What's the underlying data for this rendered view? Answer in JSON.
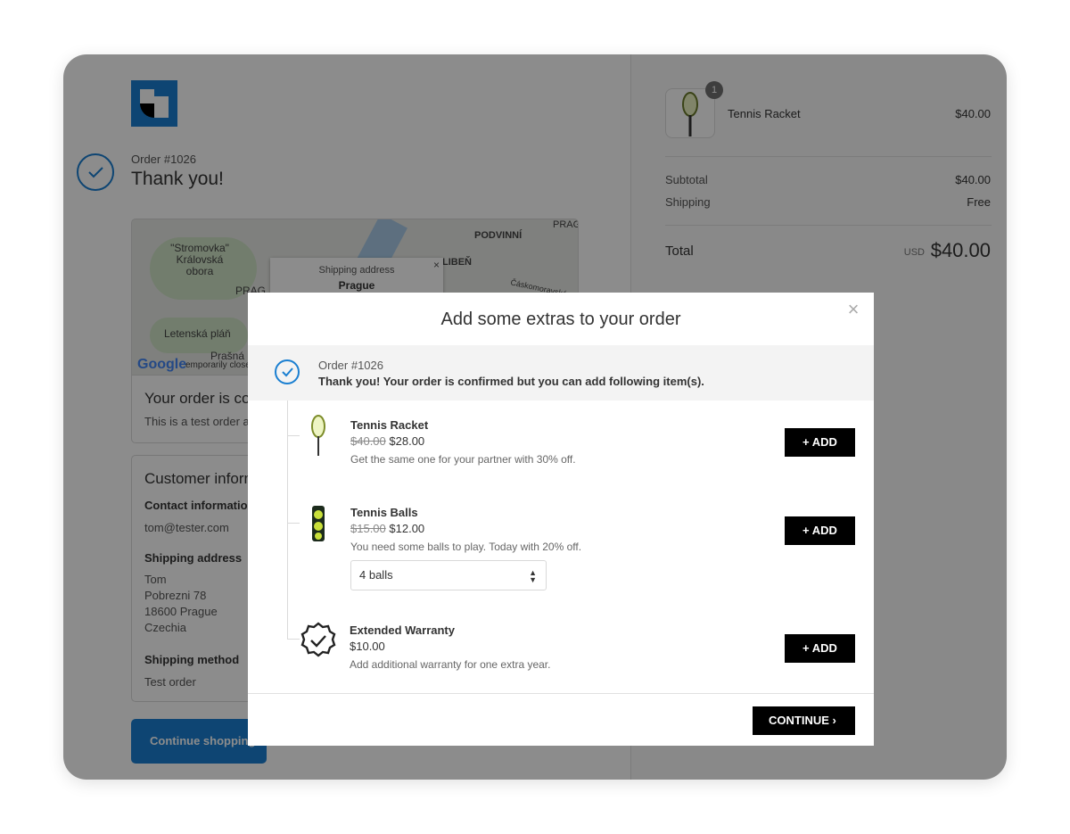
{
  "left": {
    "order_number": "Order #1026",
    "thank_you": "Thank you!",
    "map": {
      "labels": [
        "\"Stromovka\" Královská obora",
        "PRAG",
        "PODVINNÍ",
        "LIBEŇ",
        "Letenská pláň",
        "Prašná brán",
        "emporarily close",
        "Čáskomoravská",
        "PRAG"
      ],
      "popup_label": "Shipping address",
      "popup_city": "Prague",
      "popup_close": "×",
      "google": "Google"
    },
    "confirm_box": {
      "heading": "Your order is con",
      "text": "This is a test order ar"
    },
    "customer_box": {
      "heading": "Customer inform",
      "contact_label": "Contact information",
      "contact_value": "tom@tester.com",
      "shipping_label": "Shipping address",
      "address_lines": [
        "Tom",
        "Pobrezni 78",
        "18600 Prague",
        "Czechia"
      ],
      "method_label": "Shipping method",
      "method_value": "Test order"
    },
    "continue_shopping": "Continue shopping"
  },
  "summary": {
    "product_name": "Tennis Racket",
    "product_price": "$40.00",
    "quantity_badge": "1",
    "subtotal_label": "Subtotal",
    "subtotal_value": "$40.00",
    "shipping_label": "Shipping",
    "shipping_value": "Free",
    "total_label": "Total",
    "currency": "USD",
    "total_value": "$40.00"
  },
  "modal": {
    "title": "Add some extras to your order",
    "close": "×",
    "order_number": "Order #1026",
    "confirm_message": "Thank you! Your order is confirmed but you can add following item(s).",
    "items": [
      {
        "name": "Tennis Racket",
        "old_price": "$40.00",
        "price": "$28.00",
        "description": "Get the same one for your partner with 30% off.",
        "add_label": "+  ADD"
      },
      {
        "name": "Tennis Balls",
        "old_price": "$15.00",
        "price": "$12.00",
        "description": "You need some balls to play. Today with 20% off.",
        "add_label": "+  ADD",
        "select_value": "4 balls"
      },
      {
        "name": "Extended Warranty",
        "old_price": "",
        "price": "$10.00",
        "description": "Add additional warranty for one extra year.",
        "add_label": "+  ADD"
      }
    ],
    "continue_label": "CONTINUE  ›"
  },
  "colors": {
    "accent": "#1a7fd1",
    "button": "#000000",
    "overlay": "rgba(0,0,0,0.45)"
  }
}
